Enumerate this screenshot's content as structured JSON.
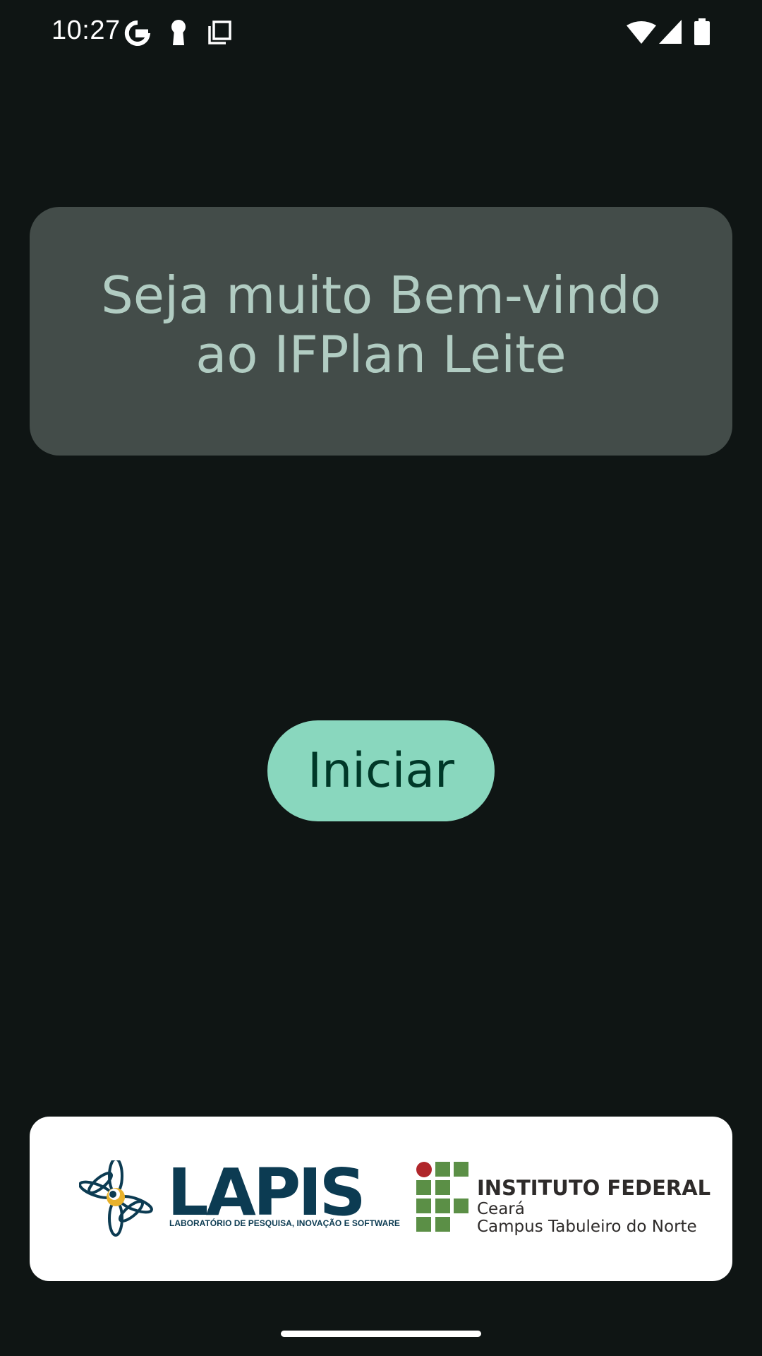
{
  "status_bar": {
    "time": "10:27",
    "left_icons": [
      "google-icon",
      "keyhole-icon",
      "copy-icon"
    ],
    "right_icons": [
      "wifi-icon",
      "signal-icon",
      "battery-icon"
    ]
  },
  "welcome": {
    "title": "Seja muito Bem-vindo ao IFPlan Leite"
  },
  "start_button": {
    "label": "Iniciar"
  },
  "footer": {
    "lapis": {
      "name": "LAPIS",
      "tagline": "LABORATÓRIO DE PESQUISA, INOVAÇÃO E SOFTWARE"
    },
    "ifce": {
      "title": "INSTITUTO FEDERAL",
      "state": "Ceará",
      "campus": "Campus Tabuleiro do Norte"
    }
  },
  "colors": {
    "background": "#0f1514",
    "card": "#434c49",
    "welcome_text": "#b1ccc2",
    "button": "#89d7be",
    "button_text": "#003828",
    "lapis_blue": "#0c3b52",
    "if_green": "#5b8f46",
    "if_red": "#b0262b"
  }
}
